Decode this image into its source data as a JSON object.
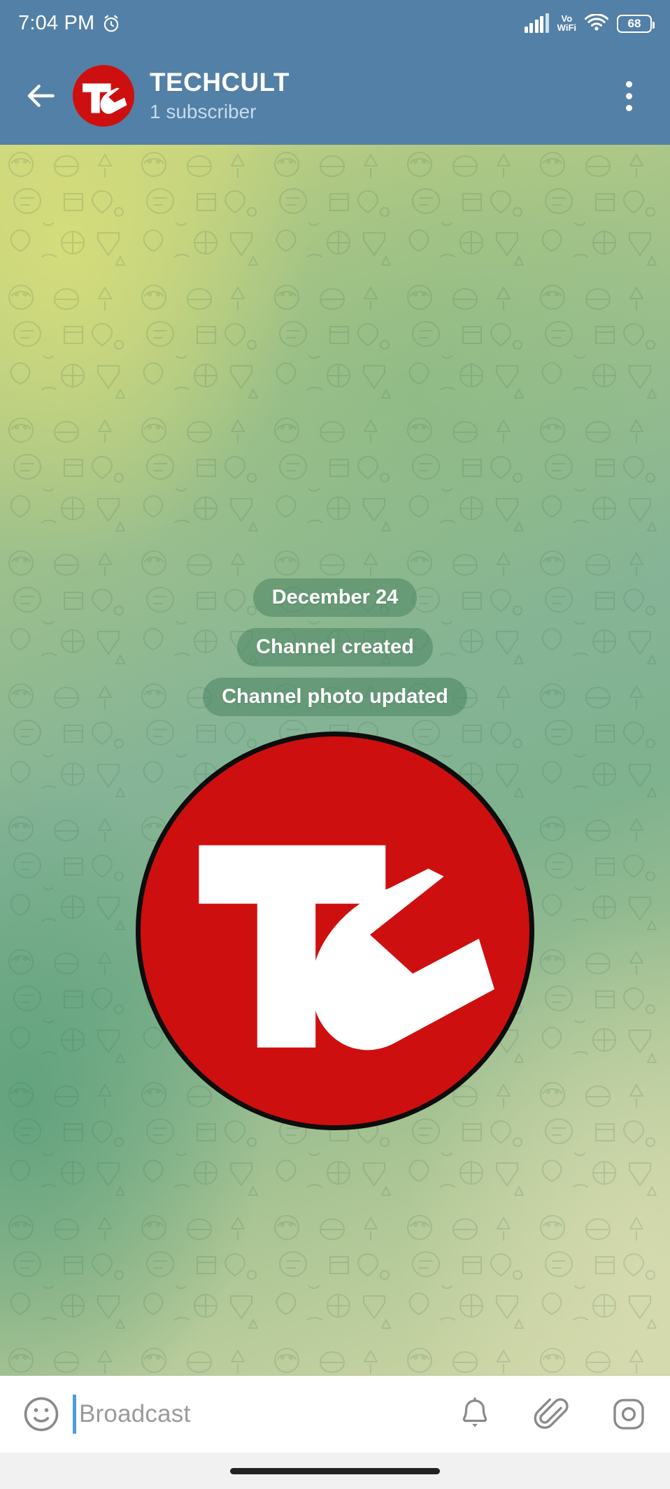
{
  "status_bar": {
    "time": "7:04 PM",
    "alarm_icon": "alarm-clock-icon",
    "signal_icon": "cellular-signal-icon",
    "vowifi_line1": "Vo",
    "vowifi_line2": "WiFi",
    "wifi_icon": "wifi-icon",
    "battery_level": "68"
  },
  "header": {
    "back_icon": "back-arrow-icon",
    "avatar_initials": "TC",
    "title": "TECHCULT",
    "subtitle": "1 subscriber",
    "menu_icon": "overflow-menu-icon"
  },
  "chat": {
    "service_messages": [
      {
        "text": "December 24"
      },
      {
        "text": "Channel created"
      },
      {
        "text": "Channel photo updated"
      }
    ],
    "channel_photo": {
      "name": "channel-photo-message",
      "initials": "TC"
    }
  },
  "input_bar": {
    "emoji_icon": "smiley-face-icon",
    "placeholder": "Broadcast",
    "bell_icon": "notification-bell-icon",
    "attach_icon": "paperclip-icon",
    "camera_icon": "camera-icon"
  },
  "nav_bar": {
    "home_indicator": "home-indicator"
  },
  "colors": {
    "header_blue": "#5380a6",
    "brand_red": "#ce0f0f",
    "pill_green": "rgba(74,132,96,.55)",
    "caret_blue": "#4a9fe0"
  }
}
